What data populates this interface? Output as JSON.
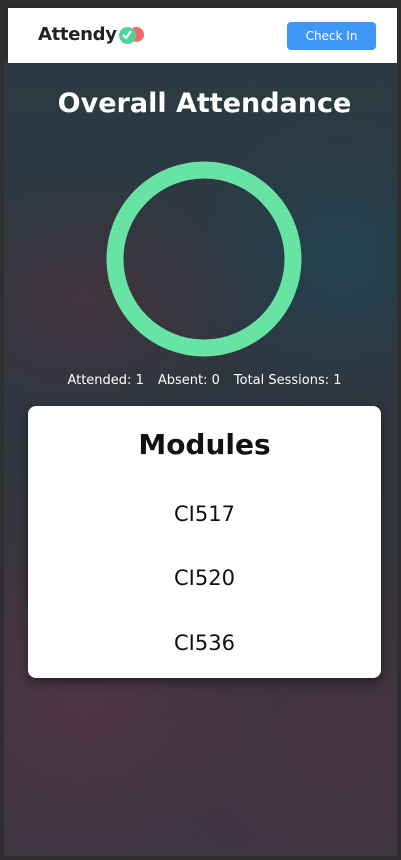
{
  "header": {
    "logo_text": "Attendy",
    "checkin_label": "Check In"
  },
  "main": {
    "title": "Overall Attendance",
    "attendance_fraction": 1,
    "stats": {
      "attended": "Attended: 1",
      "absent": "Absent: 0",
      "total": "Total Sessions: 1"
    }
  },
  "modules": {
    "title": "Modules",
    "items": [
      "CI517",
      "CI520",
      "CI536"
    ]
  },
  "colors": {
    "ring": "#67e3a3",
    "button": "#3d98f5",
    "logo_green": "#4ed39a",
    "logo_red": "#f06a6a"
  }
}
